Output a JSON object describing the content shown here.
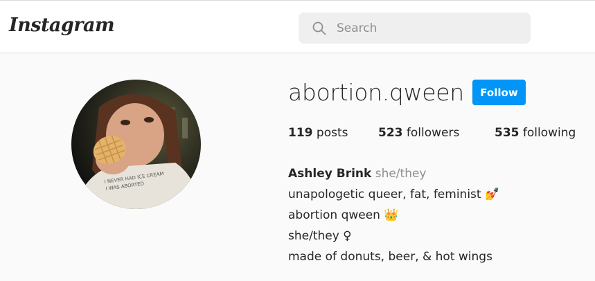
{
  "header": {
    "logo_text": "Instagram",
    "search": {
      "placeholder": "Search",
      "value": ""
    }
  },
  "profile": {
    "username": "abortion.qween",
    "follow_label": "Follow",
    "accent_color": "#0095f6",
    "stats": {
      "posts_count": "119",
      "posts_label": "posts",
      "followers_count": "523",
      "followers_label": "followers",
      "following_count": "535",
      "following_label": "following"
    },
    "bio": {
      "name": "Ashley Brink",
      "pronouns": "she/they",
      "line1": "unapologetic queer, fat, feminist",
      "line1_emoji": "💅",
      "line2": "abortion qween",
      "line2_emoji": "👑",
      "line3": "she/they ♀",
      "line4": "made of donuts, beer, & hot wings"
    },
    "avatar_shirt_text_1": "I NEVER HAD ICE CREAM",
    "avatar_shirt_text_2": "I WAS ABORTED"
  }
}
